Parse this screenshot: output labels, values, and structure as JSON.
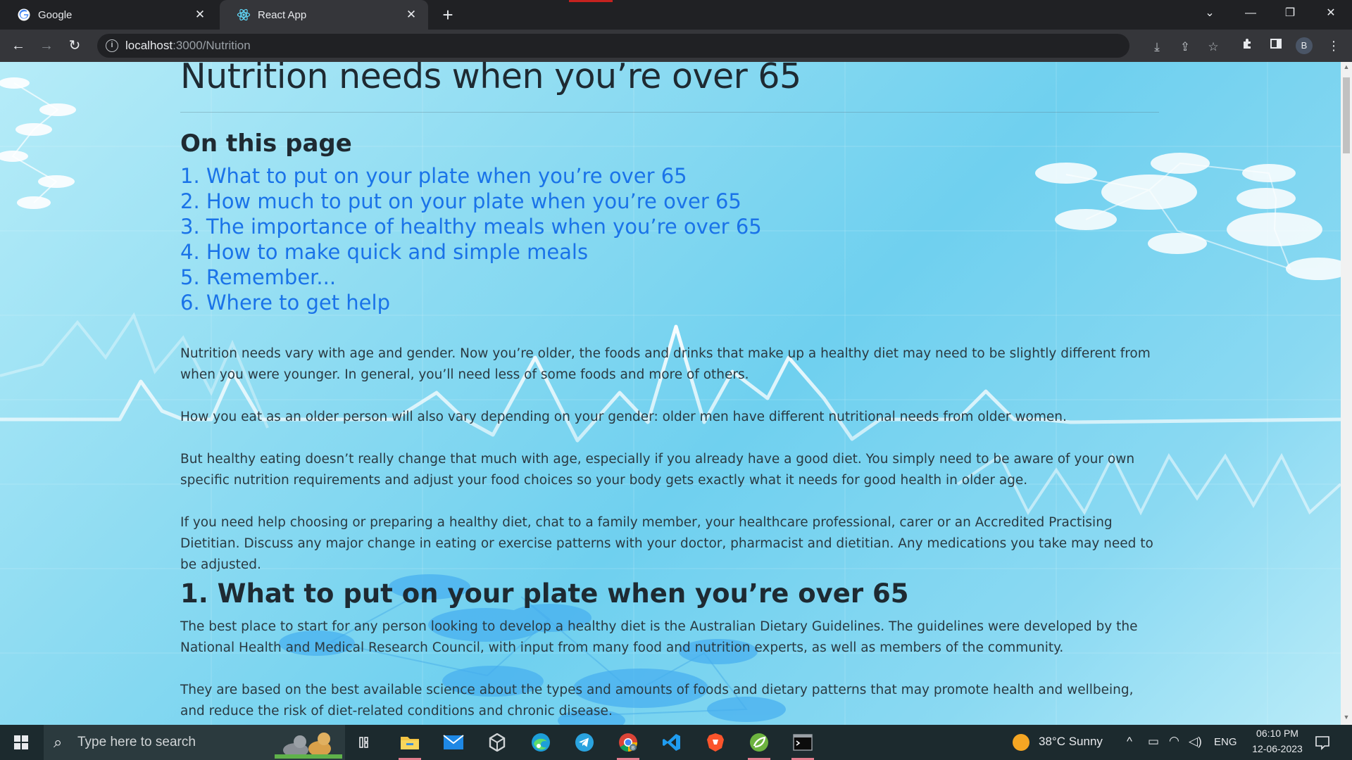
{
  "browser": {
    "tabs": [
      {
        "title": "Google",
        "icon": "google-icon"
      },
      {
        "title": "React App",
        "icon": "react-icon"
      }
    ],
    "url_host": "localhost",
    "url_path": ":3000/Nutrition"
  },
  "page": {
    "title": "Nutrition needs when you’re over 65",
    "toc_heading": "On this page",
    "toc": [
      "1. What to put on your plate when you’re over 65",
      "2. How much to put on your plate when you’re over 65",
      "3. The importance of healthy meals when you’re over 65",
      "4. How to make quick and simple meals",
      "5. Remember...",
      "6. Where to get help"
    ],
    "paragraphs": [
      "Nutrition needs vary with age and gender. Now you’re older, the foods and drinks that make up a healthy diet may need to be slightly different from when you were younger. In general, you’ll need less of some foods and more of others.",
      "How you eat as an older person will also vary depending on your gender: older men have different nutritional needs from older women.",
      "But healthy eating doesn’t really change that much with age, especially if you already have a good diet. You simply need to be aware of your own specific nutrition requirements and adjust your food choices so your body gets exactly what it needs for good health in older age.",
      "If you need help choosing or preparing a healthy diet, chat to a family member, your healthcare professional, carer or an Accredited Practising Dietitian. Discuss any major change in eating or exercise patterns with your doctor, pharmacist and dietitian. Any medications you take may need to be adjusted."
    ],
    "section1": {
      "heading": "1. What to put on your plate when you’re over 65",
      "paragraphs": [
        "The best place to start for any person looking to develop a healthy diet is the Australian Dietary Guidelines. The guidelines were developed by the National Health and Medical Research Council, with input from many food and nutrition experts, as well as members of the community.",
        "They are based on the best available science about the types and amounts of foods and dietary patterns that may promote health and wellbeing, and reduce the risk of diet-related conditions and chronic disease."
      ]
    }
  },
  "taskbar": {
    "search_placeholder": "Type here to search",
    "weather": "38°C  Sunny",
    "language": "ENG",
    "time": "06:10 PM",
    "date": "12-06-2023",
    "profile_initial": "B"
  },
  "colors": {
    "link": "#1a73e8",
    "background_accent": "#6fd0ef",
    "taskbar": "#1c2a2e"
  }
}
